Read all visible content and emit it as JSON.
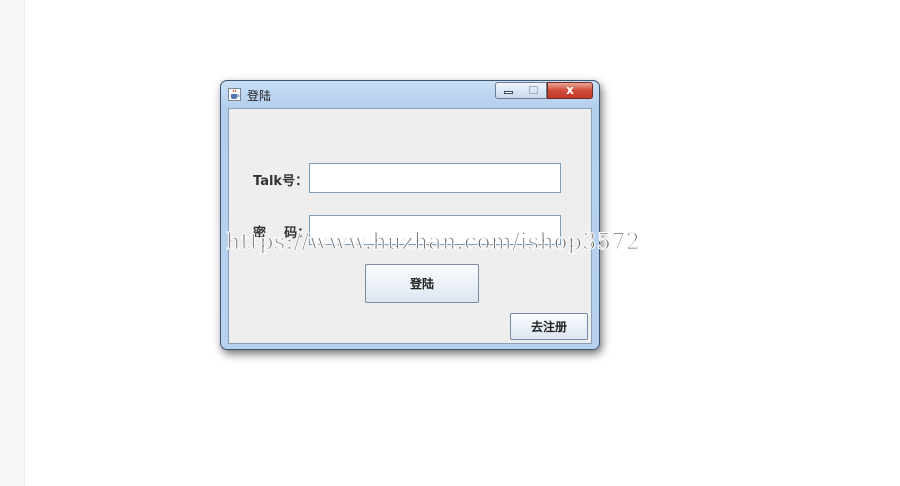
{
  "window": {
    "title": "登陆",
    "close_glyph": "x",
    "app_icon": "java-cup-icon"
  },
  "form": {
    "talk_label": "Talk号：",
    "password_label": "密    码：",
    "talk_value": "",
    "password_value": "",
    "login_button": "登陆",
    "register_button": "去注册"
  },
  "watermark": "https://www.huzhan.com/ishop3572"
}
